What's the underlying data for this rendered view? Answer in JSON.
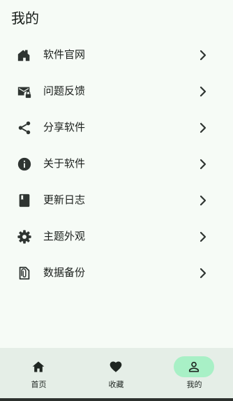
{
  "header": {
    "title": "我的"
  },
  "menu": {
    "items": [
      {
        "label": "软件官网",
        "icon": "home-icon"
      },
      {
        "label": "问题反馈",
        "icon": "mail-lock-icon"
      },
      {
        "label": "分享软件",
        "icon": "share-icon"
      },
      {
        "label": "关于软件",
        "icon": "info-icon"
      },
      {
        "label": "更新日志",
        "icon": "book-icon"
      },
      {
        "label": "主题外观",
        "icon": "gear-icon"
      },
      {
        "label": "数据备份",
        "icon": "file-clip-icon"
      }
    ]
  },
  "bottom_nav": {
    "items": [
      {
        "label": "首页",
        "icon": "home-icon"
      },
      {
        "label": "收藏",
        "icon": "heart-icon"
      },
      {
        "label": "我的",
        "icon": "person-icon",
        "active": true
      }
    ]
  },
  "colors": {
    "background": "#f6fbf6",
    "nav_background": "#e5eee7",
    "active_pill": "#a8f0c6",
    "icon": "#2f3532"
  }
}
